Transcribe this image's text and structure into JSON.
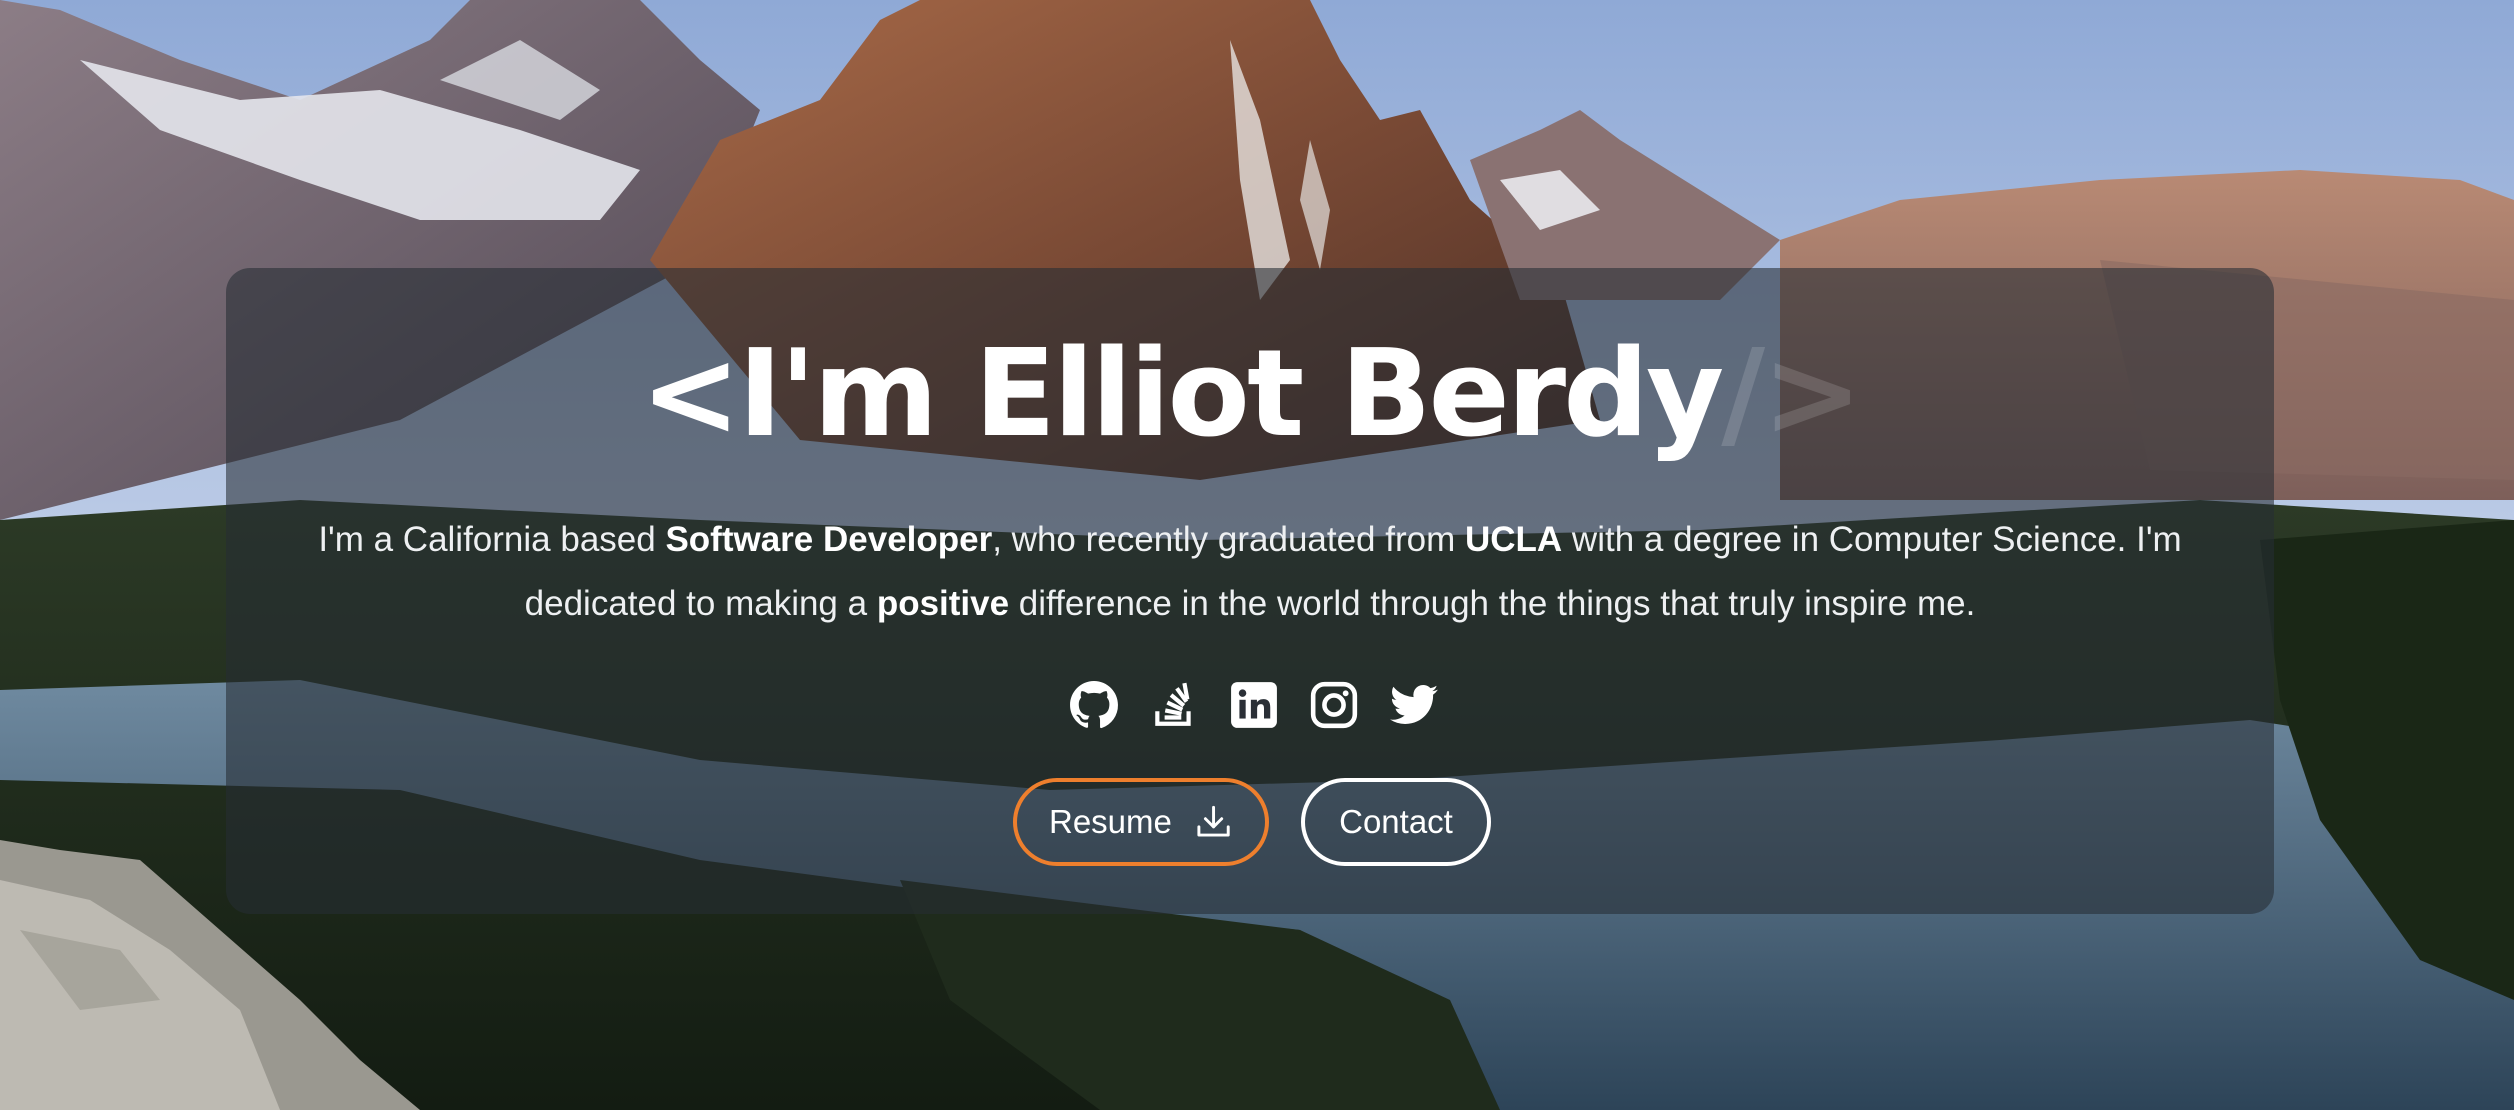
{
  "hero": {
    "title_main": "<I'm Elliot Berdy",
    "title_tag_end": "/>",
    "bio": {
      "p1": "I'm a California based ",
      "role": "Software Developer",
      "p2": ", who recently graduated from ",
      "school": "UCLA",
      "p3": " with a degree in Computer Science. I'm dedicated to making a ",
      "emphasis": "positive",
      "p4": " difference in the world through the things that truly inspire me."
    }
  },
  "socials": [
    {
      "icon": "github-icon"
    },
    {
      "icon": "stack-overflow-icon"
    },
    {
      "icon": "linkedin-icon"
    },
    {
      "icon": "instagram-icon"
    },
    {
      "icon": "twitter-icon"
    }
  ],
  "buttons": {
    "resume_label": "Resume",
    "resume_icon": "download-icon",
    "contact_label": "Contact"
  },
  "colors": {
    "accent": "#ee7f2d",
    "card_overlay": "rgba(38,44,52,0.58)",
    "text": "#ffffff"
  }
}
